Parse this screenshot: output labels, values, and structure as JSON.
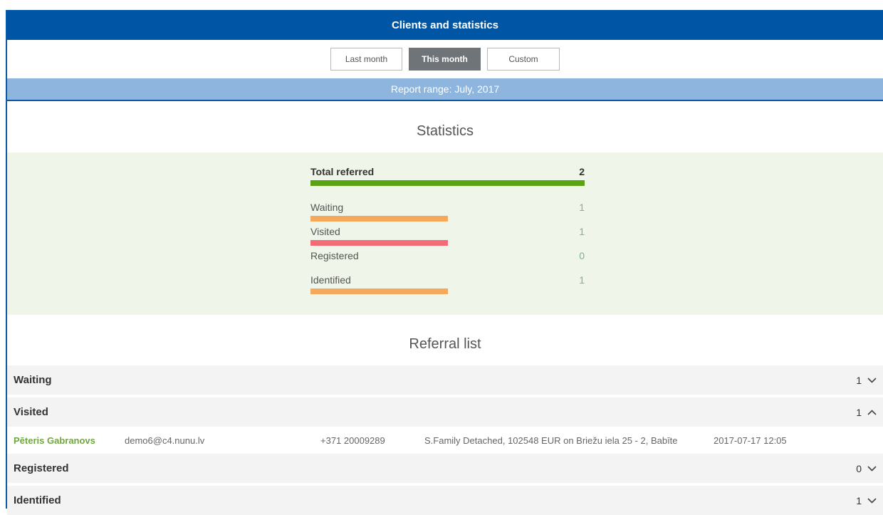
{
  "header": {
    "title": "Clients and statistics"
  },
  "range_buttons": [
    {
      "label": "Last month",
      "active": false
    },
    {
      "label": "This month",
      "active": true
    },
    {
      "label": "Custom",
      "active": false
    }
  ],
  "report_range": "Report range: July, 2017",
  "statistics": {
    "title": "Statistics",
    "total": {
      "label": "Total referred",
      "value": "2",
      "color": "#5aa414"
    },
    "items": [
      {
        "label": "Waiting",
        "value": "1",
        "fraction": 0.5,
        "color": "#f5a95c"
      },
      {
        "label": "Visited",
        "value": "1",
        "fraction": 0.5,
        "color": "#f46b78"
      },
      {
        "label": "Registered",
        "value": "0",
        "fraction": 0,
        "color": "#f5a95c"
      },
      {
        "label": "Identified",
        "value": "1",
        "fraction": 0.5,
        "color": "#f5a95c"
      }
    ]
  },
  "referral_list": {
    "title": "Referral list",
    "groups": [
      {
        "label": "Waiting",
        "count": "1",
        "expanded": false
      },
      {
        "label": "Visited",
        "count": "1",
        "expanded": true,
        "clients": [
          {
            "name": "Pēteris Gabranovs",
            "email": "demo6@c4.nunu.lv",
            "phone": "+371 20009289",
            "property": "S.Family Detached, 102548 EUR on Briežu iela 25 - 2, Babīte",
            "datetime": "2017-07-17 12:05"
          }
        ]
      },
      {
        "label": "Registered",
        "count": "0",
        "expanded": false
      },
      {
        "label": "Identified",
        "count": "1",
        "expanded": false
      }
    ]
  },
  "icons": {
    "collapsed": "chevron-down-icon",
    "expanded": "chevron-up-icon"
  }
}
